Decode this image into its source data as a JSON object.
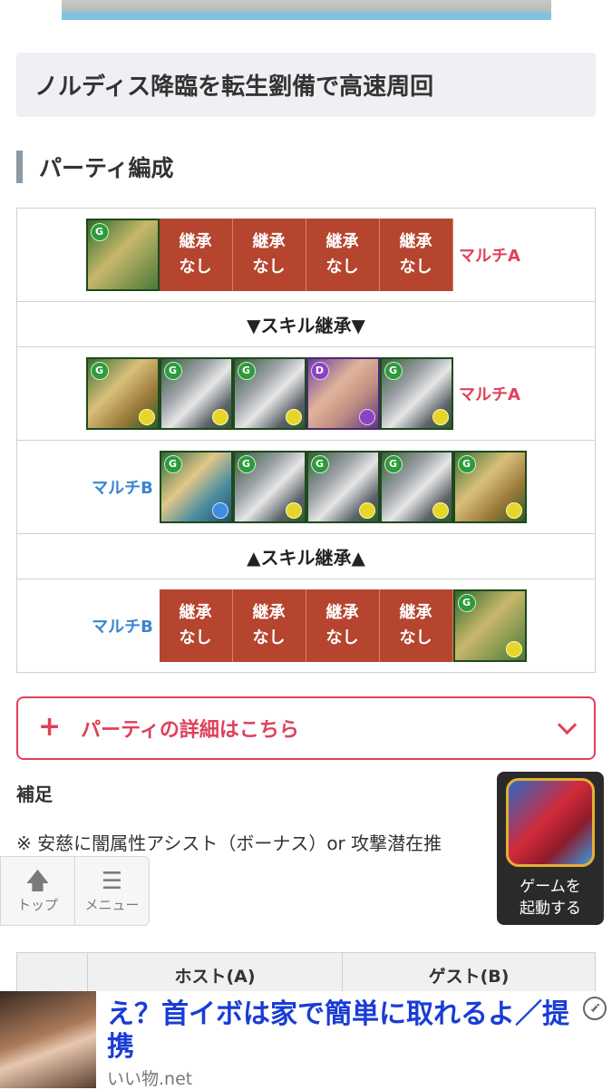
{
  "article_title": "ノルディス降臨を転生劉備で高速周回",
  "section_heading": "パーティ編成",
  "party": {
    "none_cell": {
      "line1": "継承",
      "line2": "なし"
    },
    "multi_a": "マルチA",
    "multi_b": "マルチB",
    "skill_inherit_down": "▼スキル継承▼",
    "skill_inherit_up": "▲スキル継承▲"
  },
  "detail_button": {
    "icon": "+",
    "label": "パーティの詳細はこちら"
  },
  "supplement": {
    "label": "補足",
    "text": "※ 安慈に闇属性アシスト（ボーナス）or 攻撃潜在推"
  },
  "floating_nav": {
    "top": "トップ",
    "menu": "メニュー"
  },
  "game_launcher": {
    "line1": "ゲームを",
    "line2": "起動する"
  },
  "bottom_table": {
    "col1": "",
    "col2": "ホスト(A)",
    "col3": "ゲスト(B)"
  },
  "ad": {
    "headline": "え？首イボは家で簡単に取れるよ／提携",
    "source": "いい物.net"
  },
  "colors": {
    "accent": "#e0405a",
    "inherit_none": "#b5452f",
    "multi_b": "#3a86d0",
    "title_bg": "#eef0f3"
  }
}
